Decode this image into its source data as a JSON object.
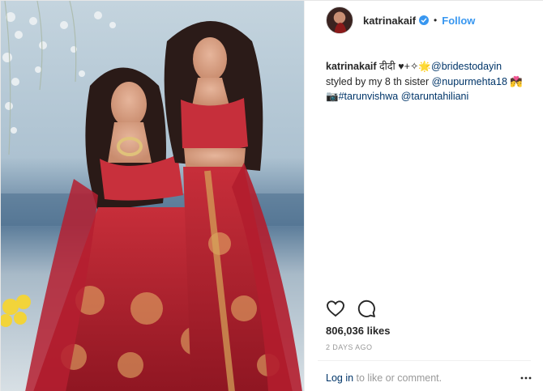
{
  "post": {
    "username": "katrinakaif",
    "separator": "•",
    "follow_label": "Follow",
    "caption": {
      "username": "katrinakaif",
      "line1_text": " दीदी ♥+✧🌟",
      "mention_bridestoday": "@bridestodayin",
      "line2_text": "styled by my 8 th sister ",
      "mention_nupur": "@nupurmehta18",
      "line2_emoji": " 💏",
      "line3_camera": "📷",
      "hashtag": "#tarunvishwa",
      "mention_tarun": "@taruntahiliani"
    },
    "likes": "806,036 likes",
    "timestamp": "2 DAYS AGO",
    "login_link": "Log in",
    "login_rest": " to like or comment."
  },
  "icons": {
    "like": "heart-icon",
    "comment": "comment-icon",
    "verified": "verified-badge-icon",
    "more": "more-options-icon"
  },
  "colors": {
    "link": "#3897f0",
    "mention": "#003569",
    "verified": "#3897f0",
    "meta": "#999999"
  }
}
